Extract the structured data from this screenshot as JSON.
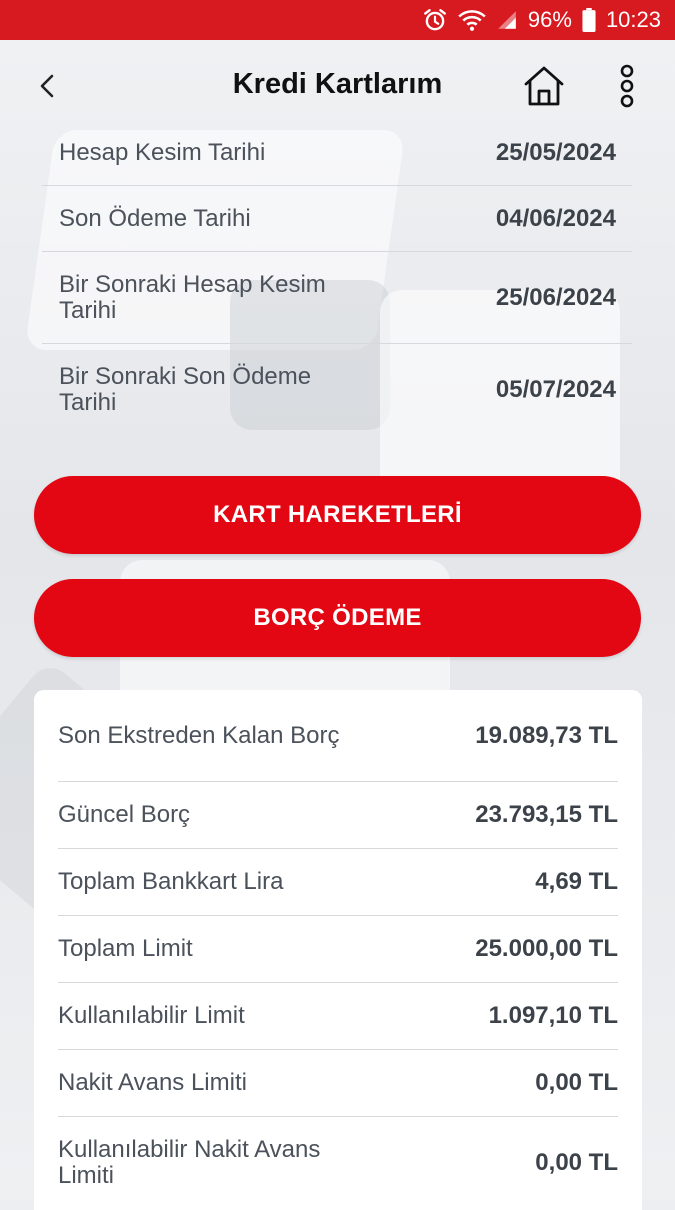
{
  "status_bar": {
    "battery": "96%",
    "time": "10:23"
  },
  "header": {
    "title": "Kredi Kartlarım"
  },
  "dates": [
    {
      "label": "Hesap Kesim Tarihi",
      "value": "25/05/2024"
    },
    {
      "label": "Son Ödeme Tarihi",
      "value": "04/06/2024"
    },
    {
      "label": "Bir Sonraki Hesap Kesim Tarihi",
      "value": "25/06/2024"
    },
    {
      "label": "Bir Sonraki Son Ödeme Tarihi",
      "value": "05/07/2024"
    }
  ],
  "buttons": {
    "kart_hareketleri": "KART HAREKETLERİ",
    "borc_odeme": "BORÇ ÖDEME"
  },
  "summary": [
    {
      "label": "Son Ekstreden Kalan Borç",
      "value": "19.089,73 TL"
    },
    {
      "label": "Güncel Borç",
      "value": "23.793,15 TL"
    },
    {
      "label": "Toplam Bankkart Lira",
      "value": "4,69 TL"
    },
    {
      "label": "Toplam Limit",
      "value": "25.000,00 TL"
    },
    {
      "label": "Kullanılabilir Limit",
      "value": "1.097,10 TL"
    },
    {
      "label": "Nakit Avans Limiti",
      "value": "0,00 TL"
    },
    {
      "label": "Kullanılabilir Nakit Avans Limiti",
      "value": "0,00 TL"
    }
  ],
  "colors": {
    "brand_red": "#e30613",
    "status_red": "#d71920"
  }
}
